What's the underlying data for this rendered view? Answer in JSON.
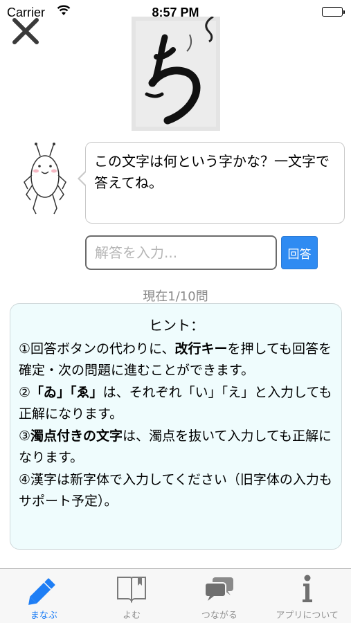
{
  "status_bar": {
    "carrier": "Carrier",
    "time": "8:57 PM"
  },
  "question": {
    "prompt": "この文字は何という字かな？一文字で答えてね。",
    "answer_placeholder": "解答を入力...",
    "answer_value": "",
    "submit_label": "回答",
    "progress": "現在1/10問"
  },
  "hint": {
    "title": "ヒント：",
    "items": [
      {
        "prefix": "①回答ボタンの代わりに、",
        "bold": "改行キー",
        "suffix": "を押しても回答を確定・次の問題に進むことができます。"
      },
      {
        "prefix": "②",
        "bold": "「ゐ」「ゑ」",
        "suffix": "は、それぞれ「い」「え」と入力しても正解になります。"
      },
      {
        "prefix": "③",
        "bold": "濁点付きの文字",
        "suffix": "は、濁点を抜いて入力しても正解になります。"
      },
      {
        "prefix": "④漢字は新字体で入力してください（旧字体の入力もサポート予定）。",
        "bold": "",
        "suffix": ""
      }
    ]
  },
  "tabs": [
    {
      "label": "まなぶ",
      "icon": "pencil-icon",
      "active": true
    },
    {
      "label": "よむ",
      "icon": "book-icon",
      "active": false
    },
    {
      "label": "つながる",
      "icon": "chat-bubbles-icon",
      "active": false
    },
    {
      "label": "アプリについて",
      "icon": "info-icon",
      "active": false
    }
  ],
  "colors": {
    "accent": "#2f8bf2",
    "tab_active": "#1e7ef5",
    "tab_inactive": "#929292",
    "hint_background": "#effcfd"
  }
}
